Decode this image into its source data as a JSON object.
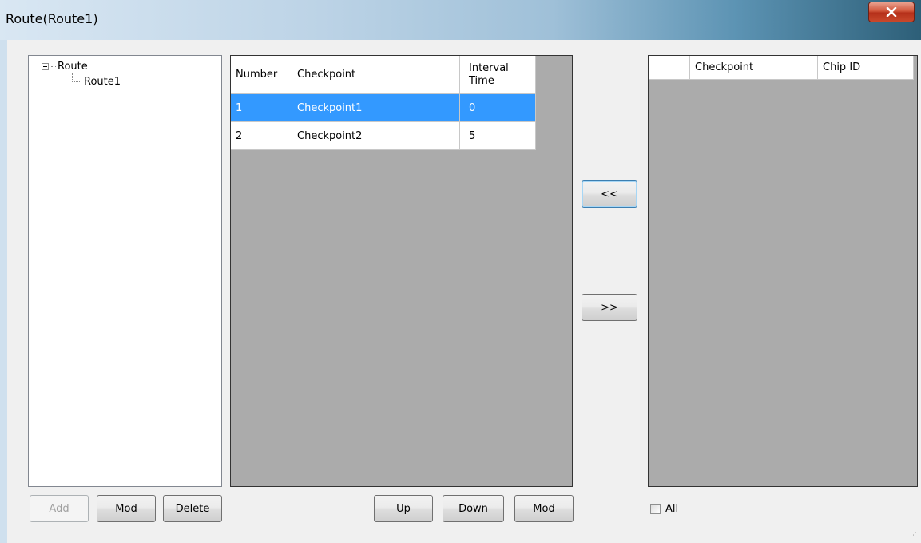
{
  "window": {
    "title": "Route(Route1)",
    "close_icon": "close-icon"
  },
  "tree": {
    "root_label": "Route",
    "children": [
      "Route1"
    ]
  },
  "checkpoint_grid": {
    "columns": [
      "Number",
      "Checkpoint",
      "Interval Time"
    ],
    "rows": [
      {
        "number": "1",
        "checkpoint": "Checkpoint1",
        "interval": "0",
        "selected": true
      },
      {
        "number": "2",
        "checkpoint": "Checkpoint2",
        "interval": "5",
        "selected": false
      }
    ]
  },
  "transfer": {
    "add_left_label": "<<",
    "remove_right_label": ">>"
  },
  "available_grid": {
    "columns": [
      "Checkpoint",
      "Chip ID"
    ]
  },
  "left_buttons": {
    "add": "Add",
    "mod": "Mod",
    "delete": "Delete"
  },
  "middle_buttons": {
    "up": "Up",
    "down": "Down",
    "mod": "Mod"
  },
  "all_checkbox": {
    "label": "All",
    "checked": false
  },
  "colors": {
    "selection": "#3399ff",
    "grid_background": "#ababab",
    "client_background": "#f0f0f0"
  }
}
